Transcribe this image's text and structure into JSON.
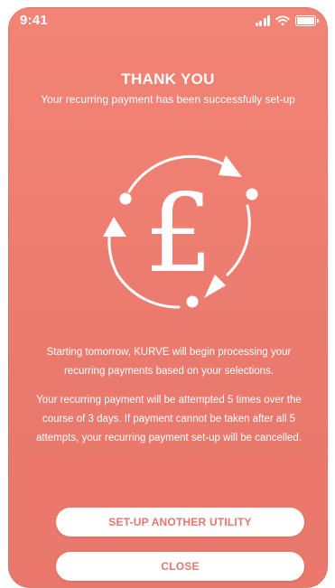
{
  "status_bar": {
    "time": "9:41",
    "icons": [
      "signal-icon",
      "wifi-icon",
      "battery-icon"
    ]
  },
  "confirmation": {
    "title": "THANK YOU",
    "subtitle": "Your recurring payment has been successfully set-up",
    "illustration_icon": "recurring-pound-icon",
    "message_1": "Starting tomorrow, KURVE will begin processing your recurring payments based on your selections.",
    "message_2": "Your recurring payment will be attempted 5 times over the course of 3 days. If payment cannot be taken after all 5 attempts, your recurring payment set-up will be cancelled.",
    "pound_symbol": "£"
  },
  "actions": {
    "setup_another_label": "SET-UP ANOTHER UTILITY",
    "close_label": "CLOSE"
  },
  "colors": {
    "background": "#EC7C6F",
    "button_background": "#FFFFFF",
    "button_text": "#E4786C",
    "text": "#FFFFFF"
  }
}
